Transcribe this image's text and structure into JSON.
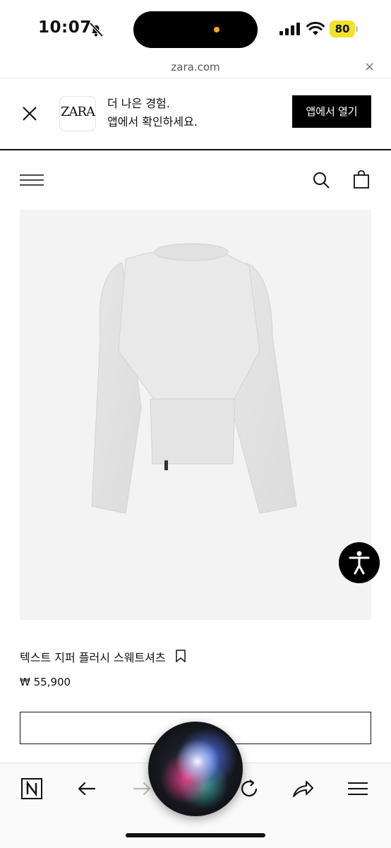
{
  "status_bar": {
    "time": "10:07",
    "battery": "80"
  },
  "url_bar": {
    "domain": "zara.com",
    "close_glyph": "×"
  },
  "app_banner": {
    "logo_text": "ZARA",
    "line1": "더 나은 경험.",
    "line2": "앱에서 확인하세요.",
    "open_button": "앱에서 열기"
  },
  "product": {
    "name": "텍스트 지퍼 플러시 스웨트셔츠",
    "price": "₩ 55,900"
  },
  "colors": {
    "accent": "#000000",
    "battery": "#f2e22b",
    "island_dot": "#f5a623",
    "image_bg": "#f3f3f3"
  },
  "icons": [
    "bell-slash-icon",
    "signal-icon",
    "wifi-icon",
    "battery-icon",
    "close-icon",
    "menu-icon",
    "search-icon",
    "shopping-bag-icon",
    "accessibility-icon",
    "bookmark-icon",
    "n-app-icon",
    "back-arrow-icon",
    "forward-arrow-icon",
    "reload-icon",
    "share-icon",
    "tab-menu-icon"
  ]
}
